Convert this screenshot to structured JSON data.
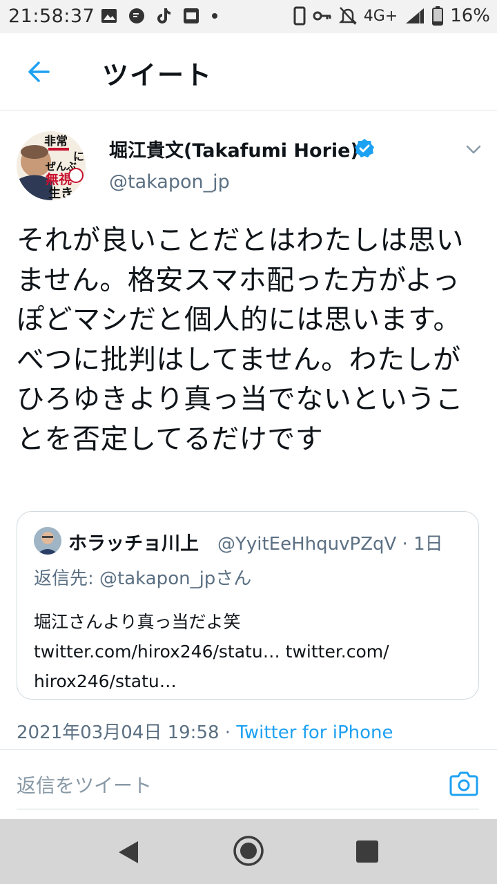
{
  "status_bar": {
    "time": "21:58:37",
    "network": "4G+",
    "battery": "16%",
    "left_icons": [
      "image-icon",
      "chat-bubble-icon",
      "tiktok-icon",
      "app-badge-icon",
      "dot-icon"
    ],
    "right_icons": [
      "phone-frame-icon",
      "key-icon",
      "mute-icon",
      "signal-icon",
      "battery-icon"
    ]
  },
  "header": {
    "title": "ツイート",
    "back_icon": "arrow-left-icon"
  },
  "tweet": {
    "author_name": "堀江貴文(Takafumi Horie)",
    "handle": "@takapon_jp",
    "avatar_text": [
      "非常識に",
      "ぜんぶ",
      "無視",
      "生き"
    ],
    "body": "それが良いことだとはわたしは思いません。格安スマホ配った方がよっぽどマシだと個人的には思います。べつに批判はしてません。わたしがひろゆきより真っ当でないということを否定してるだけです",
    "timestamp": "2021年03月04日 19:58 · ",
    "source": "Twitter for iPhone"
  },
  "quote": {
    "name": "ホラッチョ川上",
    "handle_time": "@YyitEeHhquvPZqV · 1日",
    "reply_to": "返信先: @takapon_jpさん",
    "text_line1": "堀江さんより真っ当だよ笑",
    "text_line2": "twitter.com/hirox246/statu… twitter.com/",
    "text_line3": "hirox246/statu…"
  },
  "reply": {
    "placeholder": "返信をツイート",
    "camera_icon": "camera-icon"
  },
  "colors": {
    "accent": "#1da1f2",
    "secondary_text": "#5b7083",
    "primary_text": "#0f1419",
    "divider": "#e1e8ed"
  }
}
